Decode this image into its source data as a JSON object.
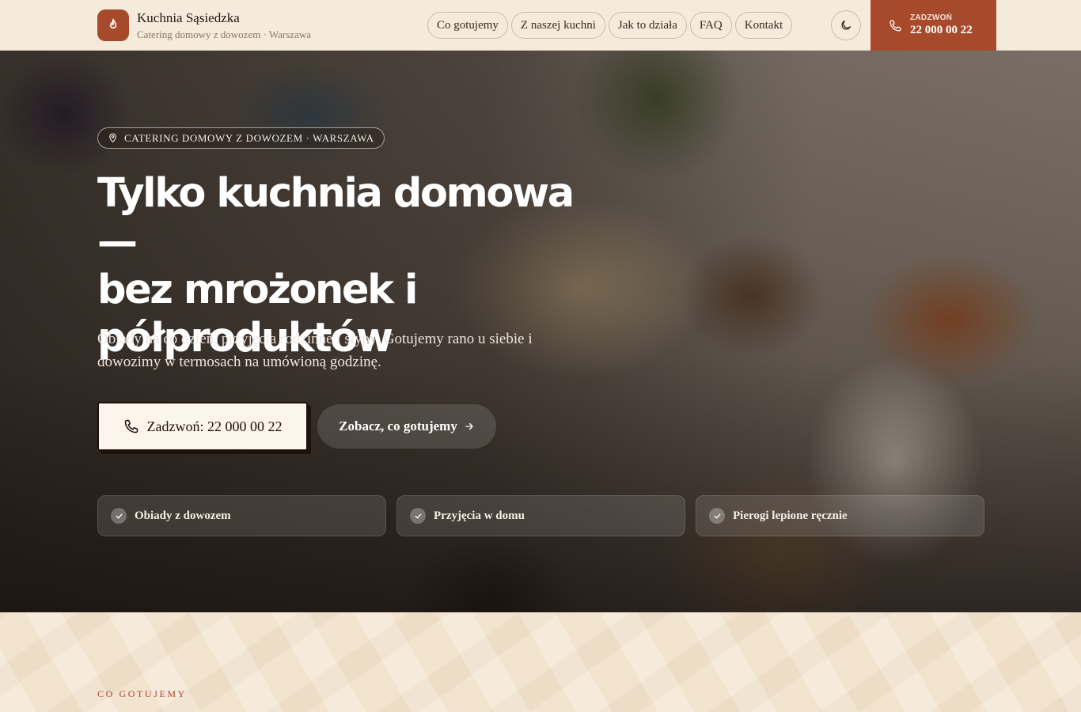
{
  "header": {
    "brand_name": "Kuchnia Sąsiedzka",
    "brand_sub": "Catering domowy z dowozem · Warszawa",
    "nav": [
      "Co gotujemy",
      "Z naszej kuchni",
      "Jak to działa",
      "FAQ",
      "Kontakt"
    ],
    "call_label": "ZADZWOŃ",
    "call_number": "22 000 00 22"
  },
  "hero": {
    "badge": "CATERING DOMOWY Z DOWOZEM · WARSZAWA",
    "title_lines": [
      "Tylko kuchnia domowa —",
      "bez mrożonek i",
      "półproduktów"
    ],
    "description": "Obiady na co dzień, przyjęcia rodzinne i stypy. Gotujemy rano u siebie i dowozimy w termosach na umówioną godzinę.",
    "cta_call": "Zadzwoń: 22 000 00 22",
    "cta_see": "Zobacz, co gotujemy",
    "features": [
      "Obiady z dowozem",
      "Przyjęcia w domu",
      "Pierogi lepione ręcznie"
    ]
  },
  "section": {
    "label": "CO GOTUJEMY"
  },
  "colors": {
    "accent": "#a64a2b",
    "header_bg": "#f5ebdc",
    "section_bg": "#f3e4cf"
  },
  "icons": {
    "brand": "flame-icon",
    "theme": "moon-icon",
    "call": "phone-icon",
    "badge": "map-pin-icon",
    "see": "arrow-right-icon",
    "feature": "check-icon"
  }
}
